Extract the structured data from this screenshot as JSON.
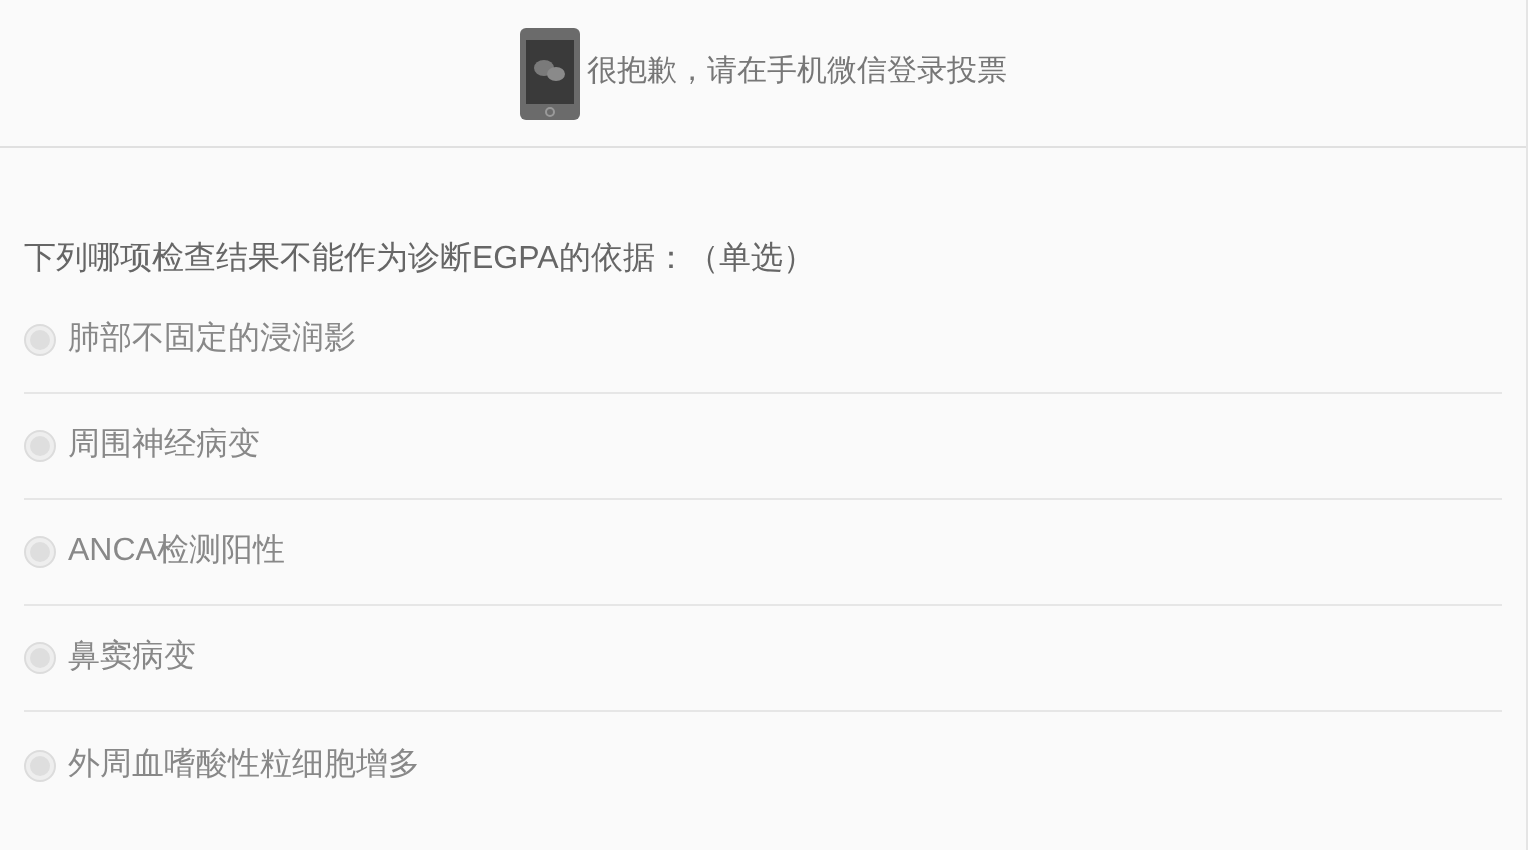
{
  "notice": {
    "text": "很抱歉，请在手机微信登录投票"
  },
  "question": {
    "text": "下列哪项检查结果不能作为诊断EGPA的依据：（单选）",
    "options": [
      {
        "label": "肺部不固定的浸润影",
        "selected": false,
        "disabled": true
      },
      {
        "label": "周围神经病变",
        "selected": false,
        "disabled": true
      },
      {
        "label": "ANCA检测阳性",
        "selected": false,
        "disabled": true
      },
      {
        "label": "鼻窦病变",
        "selected": false,
        "disabled": true
      },
      {
        "label": "外周血嗜酸性粒细胞增多",
        "selected": false,
        "disabled": true
      }
    ]
  }
}
